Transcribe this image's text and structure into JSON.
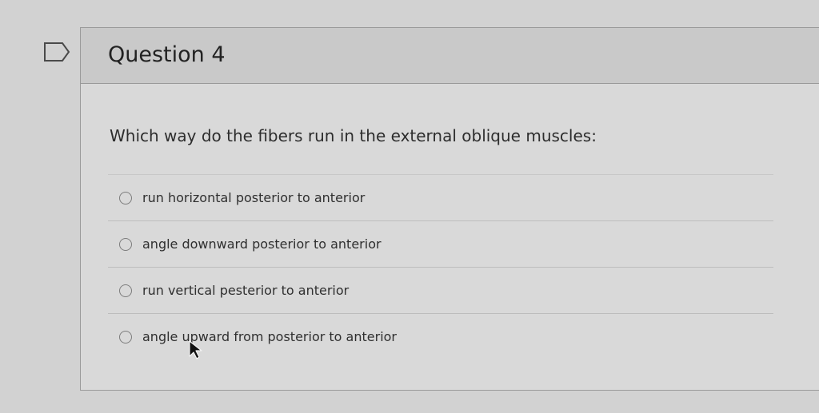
{
  "question": {
    "title": "Question 4",
    "prompt": "Which way do the fibers run in the external oblique muscles:",
    "answers": [
      {
        "label": "run horizontal posterior to anterior"
      },
      {
        "label": "angle downward posterior to anterior"
      },
      {
        "label": "run vertical pesterior to anterior"
      },
      {
        "label": "angle upward from posterior to anterior"
      }
    ]
  },
  "icons": {
    "flag": "flag-icon",
    "radio": "radio-icon",
    "cursor": "cursor-icon"
  },
  "colors": {
    "background": "#d2d2d2",
    "card": "#d9d9d9",
    "header": "#c9c9c9",
    "border": "#9a9a9a",
    "text": "#2b2b2b"
  }
}
